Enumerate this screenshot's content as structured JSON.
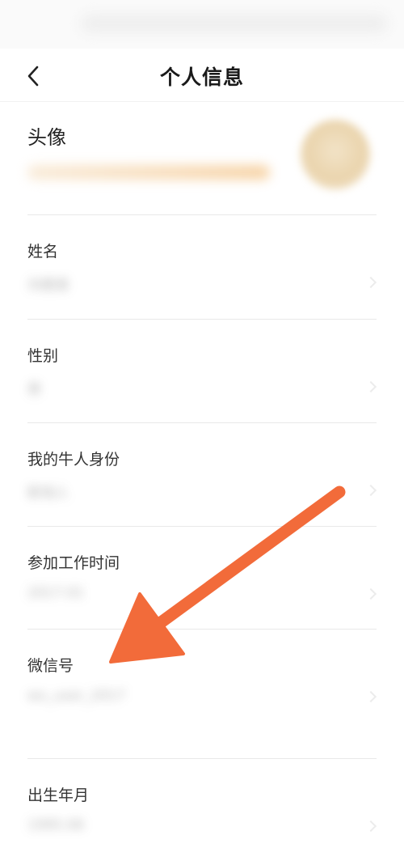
{
  "header": {
    "title": "个人信息",
    "back_icon": "chevron-left-icon"
  },
  "profile": {
    "avatar_label": "头像",
    "fields": [
      {
        "label": "姓名",
        "value": "刘德清"
      },
      {
        "label": "性别",
        "value": "男"
      },
      {
        "label": "我的牛人身份",
        "value": "职场人"
      },
      {
        "label": "参加工作时间",
        "value": "2017.01"
      },
      {
        "label": "微信号",
        "value": "wx_user_2017"
      },
      {
        "label": "出生年月",
        "value": "1995.06"
      }
    ]
  },
  "annotation": {
    "color": "#f26b3a",
    "icon": "arrow-annotation-icon",
    "target": "微信号"
  }
}
